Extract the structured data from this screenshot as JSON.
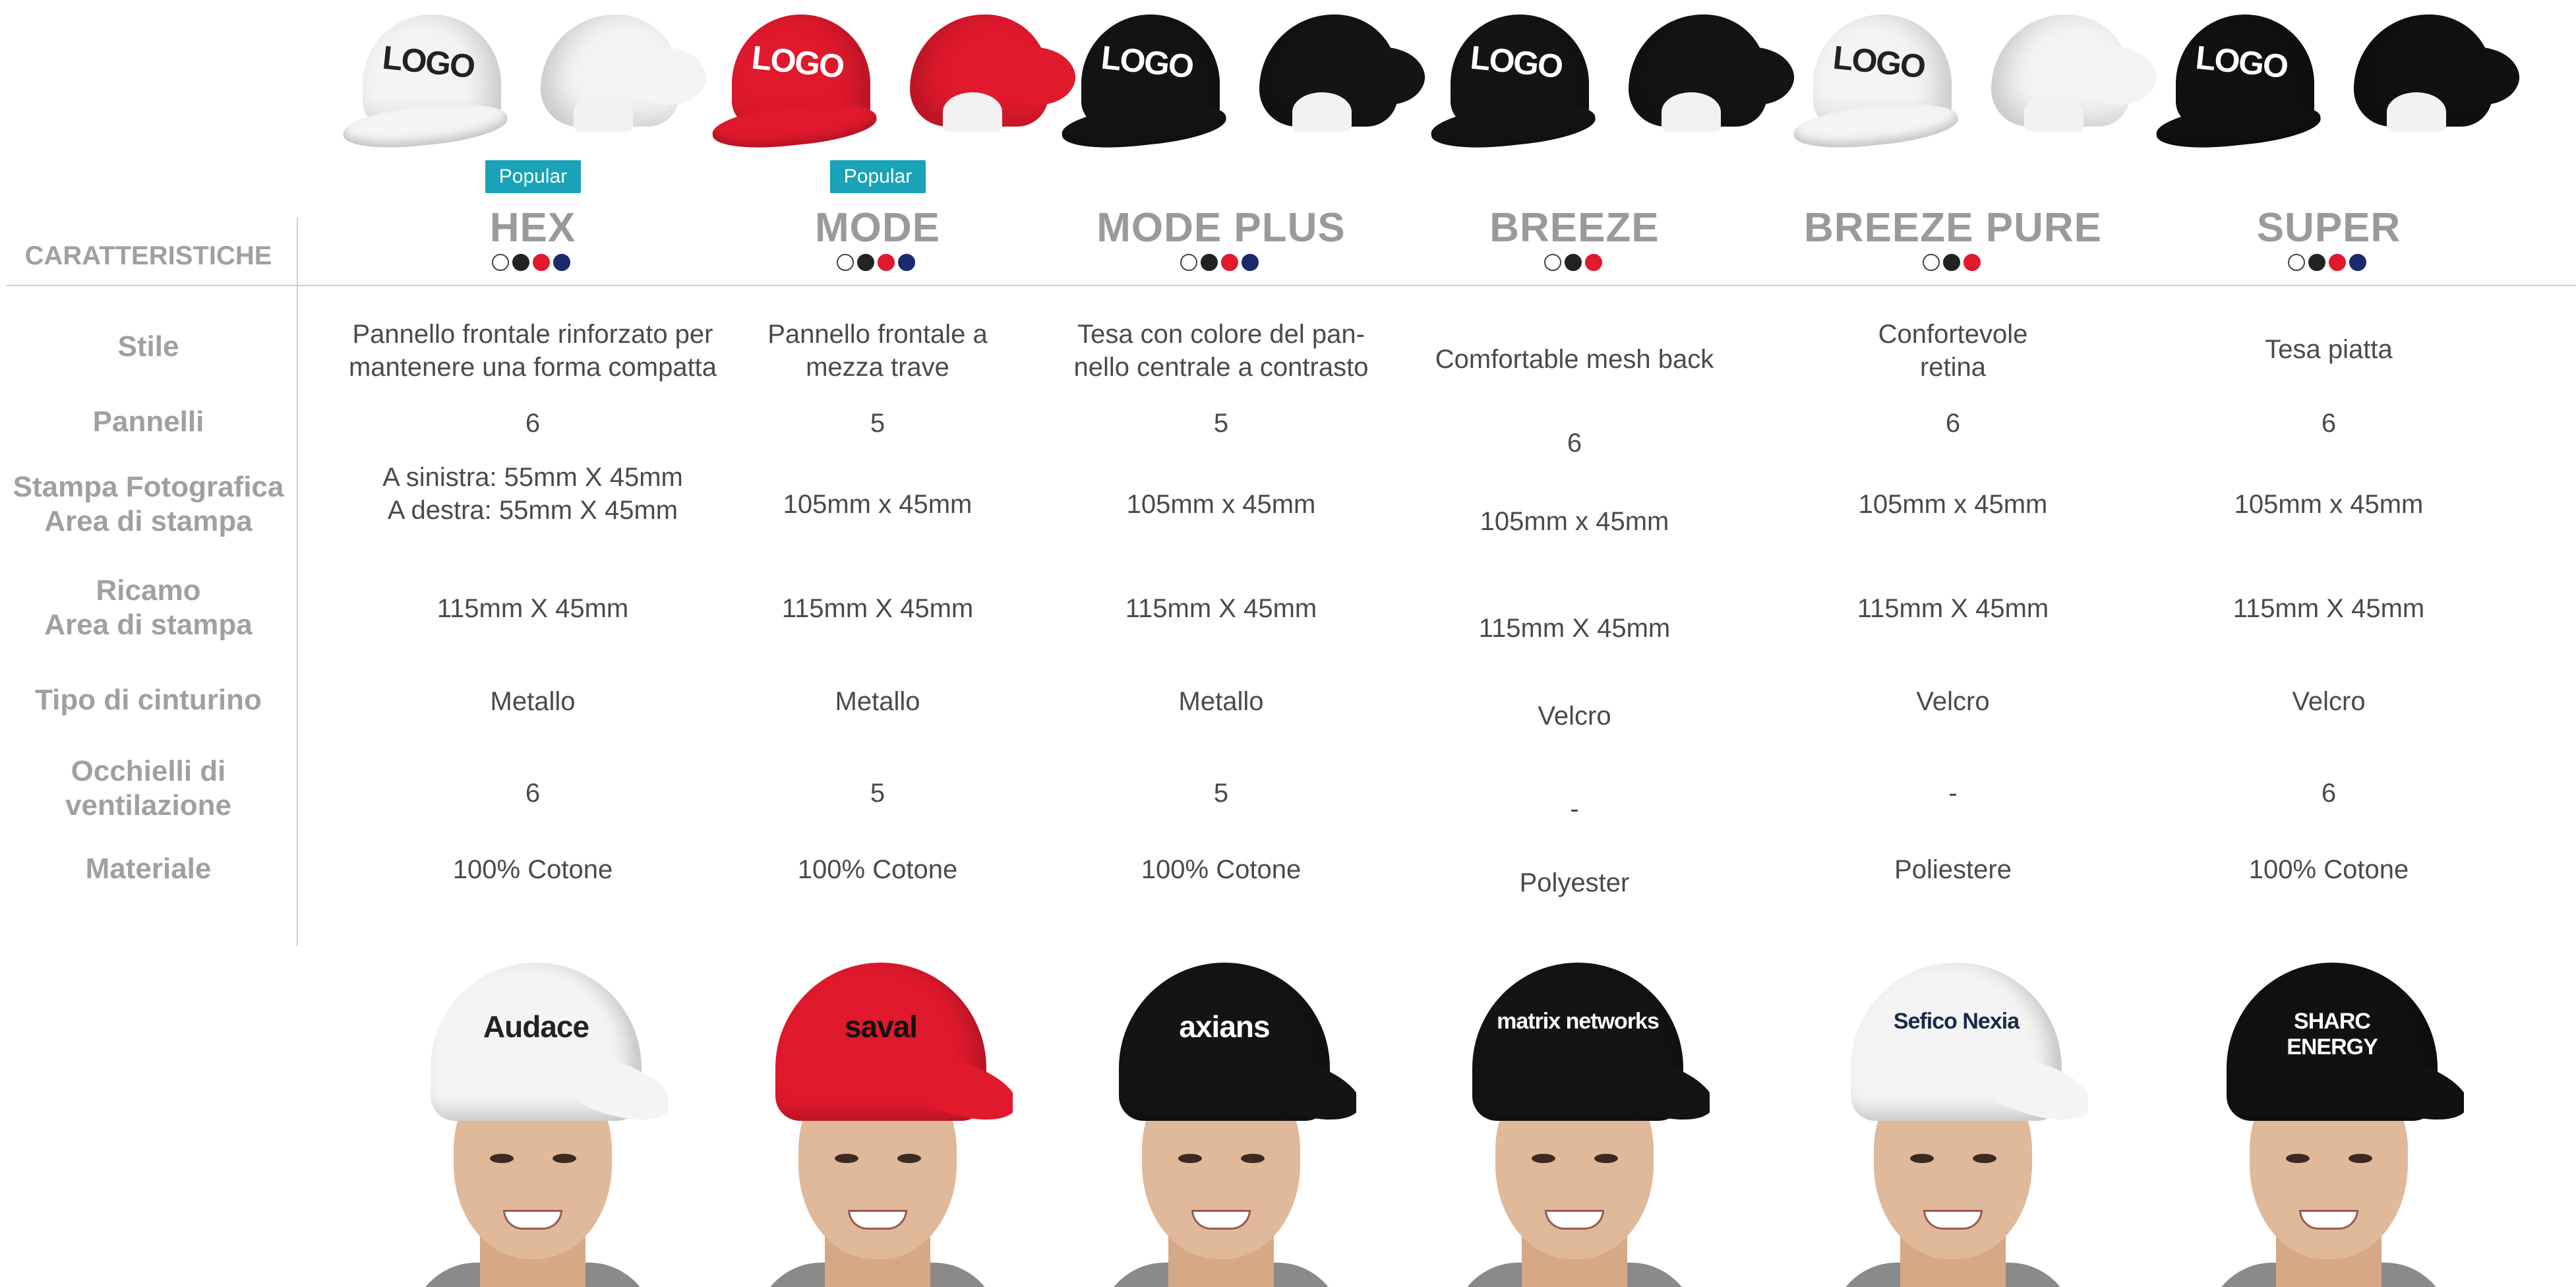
{
  "row_labels": {
    "features": "CARATTERISTICHE",
    "style": "Stile",
    "panels": "Pannelli",
    "print_line1": "Stampa Fotografica",
    "print_line2": "Area di stampa",
    "embroidery_line1": "Ricamo",
    "embroidery_line2": "Area di stampa",
    "strap": "Tipo di cinturino",
    "eyelets_line1": "Occhielli di",
    "eyelets_line2": "ventilazione",
    "material": "Materiale"
  },
  "badge_label": "Popular",
  "cap_logo_text": "LOGO",
  "models": [
    {
      "name": "HEX",
      "popular": true,
      "cap_color": "#f4f4f4",
      "logo_color": "#222222",
      "swatches": [
        "#ffffff",
        "#222222",
        "#e0192d",
        "#1a2a6c"
      ],
      "style_line1": "Pannello frontale rinforzato per",
      "style_line2": "mantenere una forma compatta",
      "panels": "6",
      "print_line1": "A sinistra: 55mm X 45mm",
      "print_line2": "A destra: 55mm X 45mm",
      "embroidery": "115mm X 45mm",
      "strap": "Metallo",
      "eyelets": "6",
      "material": "100% Cotone",
      "brand": "Audace",
      "brand_color": "#222222",
      "hat_color": "#f4f4f4"
    },
    {
      "name": "MODE",
      "popular": true,
      "cap_color": "#e0192d",
      "logo_color": "#ffffff",
      "swatches": [
        "#ffffff",
        "#222222",
        "#e0192d",
        "#1a2a6c"
      ],
      "style_line1": "Pannello frontale a",
      "style_line2": "mezza trave",
      "panels": "5",
      "print_line1": "105mm x 45mm",
      "print_line2": "",
      "embroidery": "115mm X 45mm",
      "strap": "Metallo",
      "eyelets": "5",
      "material": "100% Cotone",
      "brand": "saval",
      "brand_color": "#111111",
      "hat_color": "#e0192d"
    },
    {
      "name": "MODE PLUS",
      "popular": false,
      "cap_color": "#141414",
      "logo_color": "#ffffff",
      "swatches": [
        "#ffffff",
        "#222222",
        "#e0192d",
        "#1a2a6c"
      ],
      "style_line1": "Tesa con colore del pan-",
      "style_line2": "nello centrale a contrasto",
      "panels": "5",
      "print_line1": "105mm x 45mm",
      "print_line2": "",
      "embroidery": "115mm X 45mm",
      "strap": "Metallo",
      "eyelets": "5",
      "material": "100% Cotone",
      "brand": "axians",
      "brand_color": "#ffffff",
      "hat_color": "#141414"
    },
    {
      "name": "BREEZE",
      "popular": false,
      "cap_color": "#141414",
      "logo_color": "#ffffff",
      "swatches": [
        "#ffffff",
        "#222222",
        "#e0192d"
      ],
      "style_line1": "Comfortable mesh back",
      "style_line2": "",
      "panels": "6",
      "print_line1": "105mm x 45mm",
      "print_line2": "",
      "embroidery": "115mm X 45mm",
      "strap": "Velcro",
      "eyelets": "-",
      "material": "Polyester",
      "brand": "matrix networks",
      "brand_color": "#ffffff",
      "hat_color": "#141414"
    },
    {
      "name": "BREEZE PURE",
      "popular": false,
      "cap_color": "#f4f4f4",
      "logo_color": "#222222",
      "swatches": [
        "#ffffff",
        "#222222",
        "#e0192d"
      ],
      "style_line1": "Confortevole",
      "style_line2": "retina",
      "panels": "6",
      "print_line1": "105mm x 45mm",
      "print_line2": "",
      "embroidery": "115mm X 45mm",
      "strap": "Velcro",
      "eyelets": "-",
      "material": "Poliestere",
      "brand": "Sefico Nexia",
      "brand_color": "#1b2a4a",
      "hat_color": "#f4f4f4"
    },
    {
      "name": "SUPER",
      "popular": false,
      "cap_color": "#111111",
      "logo_color": "#ffffff",
      "swatches": [
        "#ffffff",
        "#222222",
        "#e0192d",
        "#1a2a6c"
      ],
      "style_line1": "Tesa piatta",
      "style_line2": "",
      "panels": "6",
      "print_line1": "105mm x 45mm",
      "print_line2": "",
      "embroidery": "115mm X 45mm",
      "strap": "Velcro",
      "eyelets": "6",
      "material": "100% Cotone",
      "brand": "SHARC ENERGY",
      "brand_color": "#ffffff",
      "hat_color": "#111111"
    }
  ]
}
